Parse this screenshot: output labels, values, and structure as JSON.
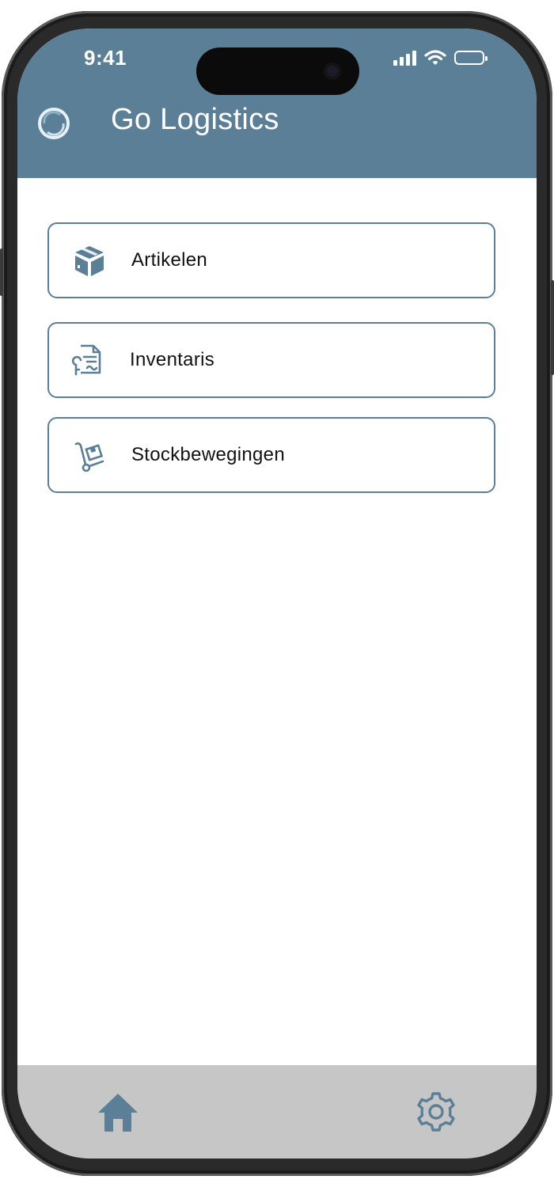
{
  "status_bar": {
    "time": "9:41"
  },
  "header": {
    "title": "Go Logistics",
    "logo_icon": "go-logistics-logo-icon"
  },
  "menu": {
    "items": [
      {
        "label": "Artikelen",
        "icon": "package-box-icon"
      },
      {
        "label": "Inventaris",
        "icon": "inventory-document-icon"
      },
      {
        "label": "Stockbewegingen",
        "icon": "hand-truck-icon"
      }
    ]
  },
  "tabbar": {
    "items": [
      {
        "icon": "home-icon"
      },
      {
        "icon": "gear-icon"
      }
    ]
  },
  "colors": {
    "primary": "#5a7f97",
    "tabbar": "#c6c6c6",
    "card_border": "#5a7f97",
    "text": "#111111"
  }
}
